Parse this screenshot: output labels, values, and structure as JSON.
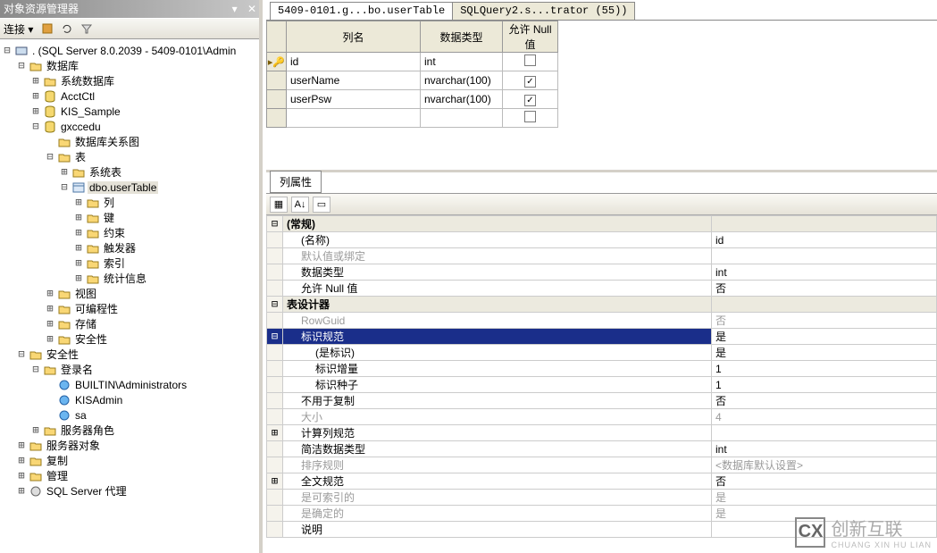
{
  "left": {
    "title": "对象资源管理器",
    "connect_label": "连接 ▾",
    "root": ". (SQL Server 8.0.2039 - 5409-0101\\Admin",
    "n_db": "数据库",
    "n_sysdb": "系统数据库",
    "n_acctctl": "AcctCtl",
    "n_kis": "KIS_Sample",
    "n_gxccedu": "gxccedu",
    "n_dbdiagrams": "数据库关系图",
    "n_tables": "表",
    "n_systables": "系统表",
    "n_usertable": "dbo.userTable",
    "n_cols": "列",
    "n_keys": "键",
    "n_constraints": "约束",
    "n_triggers": "触发器",
    "n_indexes": "索引",
    "n_stats": "统计信息",
    "n_views": "视图",
    "n_programmability": "可编程性",
    "n_storage": "存储",
    "n_security": "安全性",
    "n_security2": "安全性",
    "n_logins": "登录名",
    "n_builtin": "BUILTIN\\Administrators",
    "n_kisadmin": "KISAdmin",
    "n_sa": "sa",
    "n_serverroles": "服务器角色",
    "n_serverobjs": "服务器对象",
    "n_replication": "复制",
    "n_management": "管理",
    "n_agent": "SQL Server 代理"
  },
  "tabs": {
    "t1": "5409-0101.g...bo.userTable",
    "t2": "SQLQuery2.s...trator (55))"
  },
  "grid": {
    "h_col": "列名",
    "h_type": "数据类型",
    "h_null": "允许 Null 值",
    "rows": [
      {
        "name": "id",
        "type": "int",
        "null": false,
        "pk": true
      },
      {
        "name": "userName",
        "type": "nvarchar(100)",
        "null": true,
        "pk": false
      },
      {
        "name": "userPsw",
        "type": "nvarchar(100)",
        "null": true,
        "pk": false
      }
    ]
  },
  "props": {
    "title": "列属性",
    "cat_general": "(常规)",
    "p_name": "(名称)",
    "v_name": "id",
    "p_default": "默认值或绑定",
    "p_datatype": "数据类型",
    "v_datatype": "int",
    "p_allownull": "允许 Null 值",
    "v_allownull": "否",
    "cat_designer": "表设计器",
    "p_rowguid": "RowGuid",
    "v_rowguid": "否",
    "p_identity": "标识规范",
    "v_identity": "是",
    "p_isidentity": "(是标识)",
    "v_isidentity": "是",
    "p_increment": "标识增量",
    "v_increment": "1",
    "p_seed": "标识种子",
    "v_seed": "1",
    "p_notforrep": "不用于复制",
    "v_notforrep": "否",
    "p_size": "大小",
    "v_size": "4",
    "p_computed": "计算列规范",
    "p_concise": "简洁数据类型",
    "v_concise": "int",
    "p_collation": "排序规则",
    "v_collation": "<数据库默认设置>",
    "p_fulltext": "全文规范",
    "v_fulltext": "否",
    "p_indexable": "是可索引的",
    "v_indexable": "是",
    "p_deterministic": "是确定的",
    "v_deterministic": "是",
    "p_desc": "说明"
  },
  "watermark": {
    "brand": "创新互联",
    "sub": "CHUANG XIN HU LIAN"
  }
}
